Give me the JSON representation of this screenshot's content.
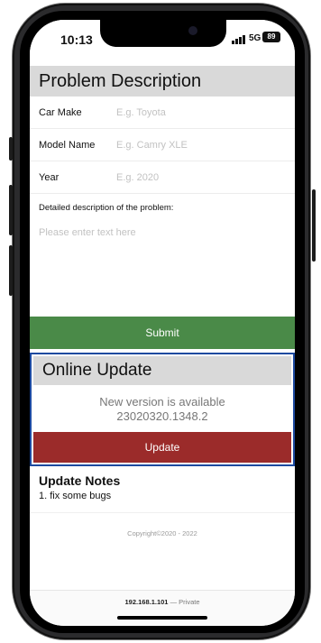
{
  "status_bar": {
    "time": "10:13",
    "network": "5G",
    "battery": "89"
  },
  "problem": {
    "title": "Problem Description",
    "fields": [
      {
        "label": "Car Make",
        "placeholder": "E.g. Toyota",
        "value": ""
      },
      {
        "label": "Model Name",
        "placeholder": "E.g. Camry XLE",
        "value": ""
      },
      {
        "label": "Year",
        "placeholder": "E.g. 2020",
        "value": ""
      }
    ],
    "description_label": "Detailed description of the problem:",
    "description_placeholder": "Please enter text here",
    "submit_label": "Submit"
  },
  "online_update": {
    "title": "Online Update",
    "message_line1": "New version is available",
    "message_line2": "23020320.1348.2",
    "button_label": "Update"
  },
  "notes": {
    "title": "Update Notes",
    "items": [
      "1. fix some bugs"
    ]
  },
  "footer": {
    "copyright": "Copyright©2020 - 2022"
  },
  "address_bar": {
    "host": "192.168.1.101",
    "suffix": "— Private"
  },
  "colors": {
    "submit": "#4a8a48",
    "update": "#9b2b2a",
    "highlight_border": "#1d4aa0",
    "header_bg": "#d9d9d9"
  }
}
